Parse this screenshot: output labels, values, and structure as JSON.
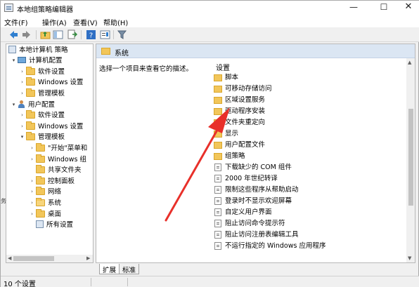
{
  "window": {
    "title": "本地组策略编辑器",
    "controls": {
      "minimize": "—",
      "maximize": "☐",
      "close": "✕"
    }
  },
  "menu": [
    "文件(F)",
    "操作(A)",
    "查看(V)",
    "帮助(H)"
  ],
  "toolbar": {
    "icons": [
      "back-arrow-icon",
      "forward-arrow-icon",
      "up-folder-icon",
      "show-hide-tree-icon",
      "export-list-icon",
      "help-icon",
      "properties-icon",
      "filter-icon"
    ]
  },
  "tree": {
    "root": "本地计算机 策略",
    "computer_config": "计算机配置",
    "cc_software": "软件设置",
    "cc_windows": "Windows 设置",
    "cc_admin": "管理模板",
    "user_config": "用户配置",
    "uc_software": "软件设置",
    "uc_windows": "Windows 设置",
    "uc_admin": "管理模板",
    "start_menu": "\"开始\"菜单和",
    "windows_comp": "Windows 组",
    "shared_folders": "共享文件夹",
    "control_panel": "控制面板",
    "network": "网络",
    "system": "系统",
    "desktop": "桌面",
    "all_settings": "所有设置"
  },
  "right": {
    "header_title": "系统",
    "description": "选择一个项目来查看它的描述。",
    "column_header": "设置",
    "items": [
      {
        "label": "脚本",
        "kind": "folder"
      },
      {
        "label": "可移动存储访问",
        "kind": "folder"
      },
      {
        "label": "区域设置服务",
        "kind": "folder"
      },
      {
        "label": "驱动程序安装",
        "kind": "folder"
      },
      {
        "label": "文件夹重定向",
        "kind": "folder"
      },
      {
        "label": "显示",
        "kind": "folder"
      },
      {
        "label": "用户配置文件",
        "kind": "folder"
      },
      {
        "label": "组策略",
        "kind": "folder"
      },
      {
        "label": "下载缺少的 COM 组件",
        "kind": "setting"
      },
      {
        "label": "2000 年世纪转译",
        "kind": "setting"
      },
      {
        "label": "限制这些程序从帮助启动",
        "kind": "setting"
      },
      {
        "label": "登录时不显示欢迎屏幕",
        "kind": "setting"
      },
      {
        "label": "自定义用户界面",
        "kind": "setting"
      },
      {
        "label": "阻止访问命令提示符",
        "kind": "setting"
      },
      {
        "label": "阻止访问注册表编辑工具",
        "kind": "setting"
      },
      {
        "label": "不运行指定的 Windows 应用程序",
        "kind": "setting"
      }
    ]
  },
  "tabs": {
    "extended": "扩展",
    "standard": "标准"
  },
  "status": "10 个设置",
  "left_edge_text": "务",
  "annotation": {
    "color": "#e8302a"
  }
}
